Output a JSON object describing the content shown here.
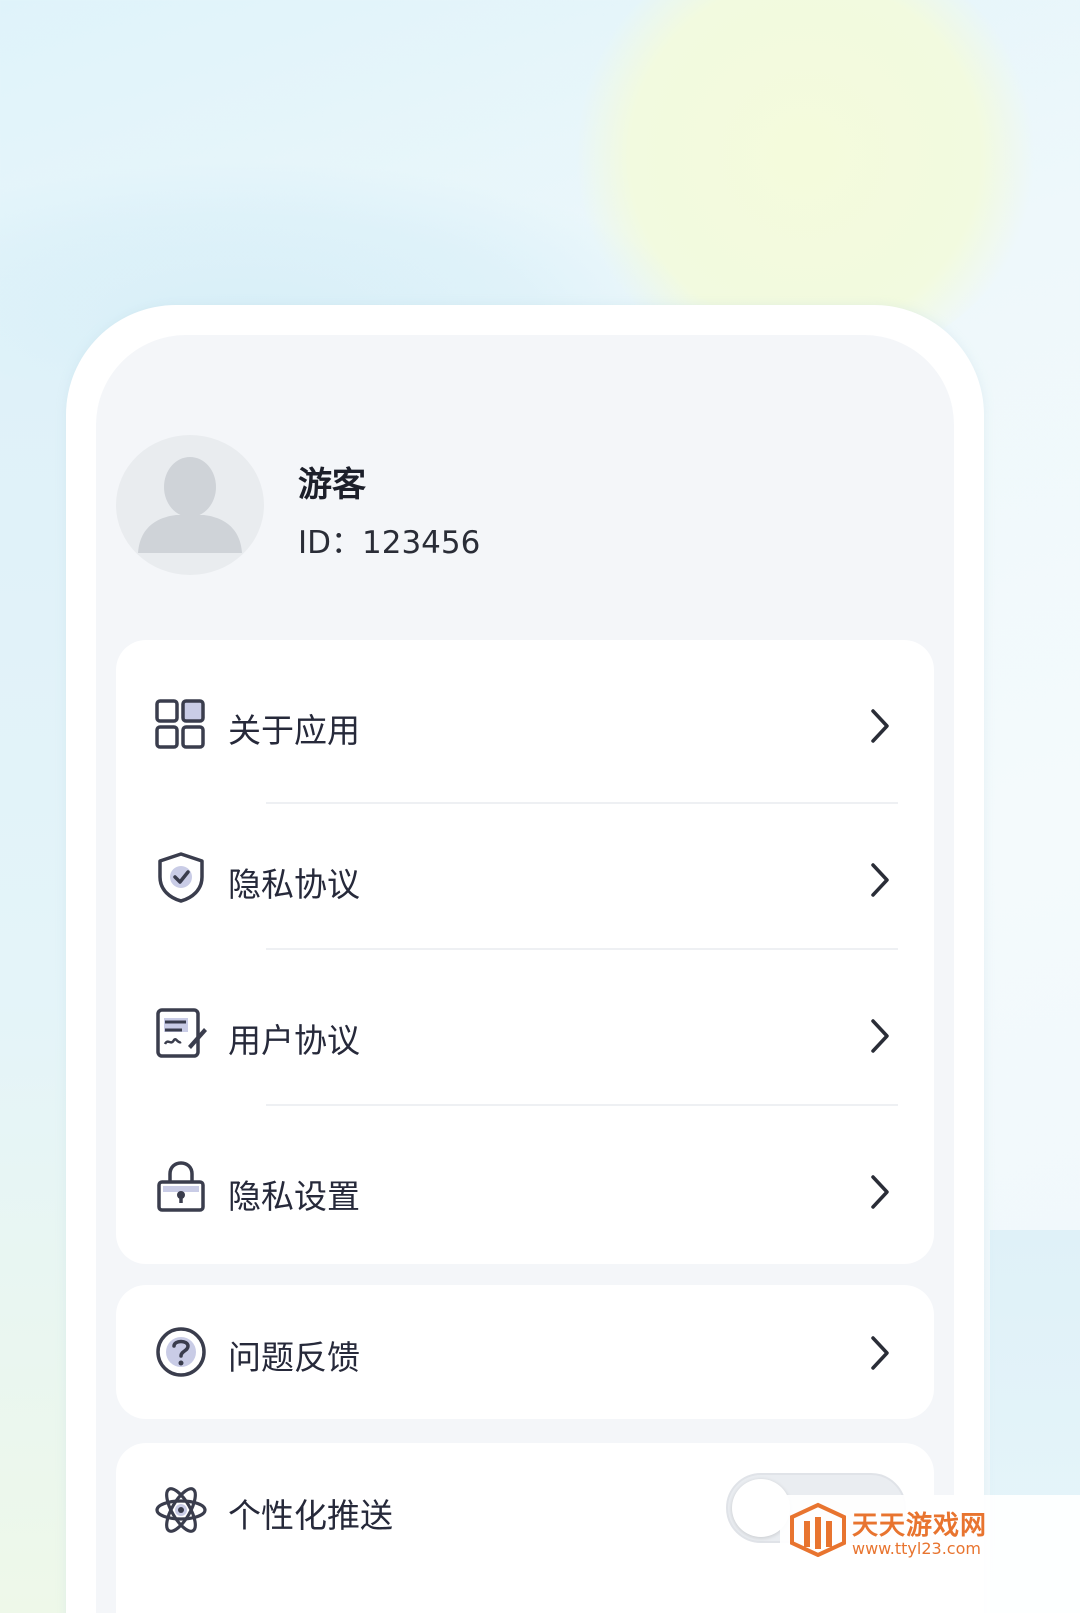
{
  "profile": {
    "name": "游客",
    "id_text": "ID：123456"
  },
  "menu_main": [
    {
      "label": "关于应用",
      "icon": "apps-grid-icon"
    },
    {
      "label": "隐私协议",
      "icon": "shield-check-icon"
    },
    {
      "label": "用户协议",
      "icon": "document-sign-icon"
    },
    {
      "label": "隐私设置",
      "icon": "lock-icon"
    }
  ],
  "menu_feedback": {
    "label": "问题反馈",
    "icon": "question-circle-icon"
  },
  "menu_push": {
    "label": "个性化推送",
    "icon": "atom-icon",
    "toggle_on": false
  },
  "watermark": {
    "title": "天天游戏网",
    "url": "www.ttyl23.com"
  },
  "colors": {
    "text_primary": "#26293a",
    "icon_stroke": "#3a3d4d",
    "icon_accent": "#c9cce6",
    "watermark": "#e8742f"
  }
}
